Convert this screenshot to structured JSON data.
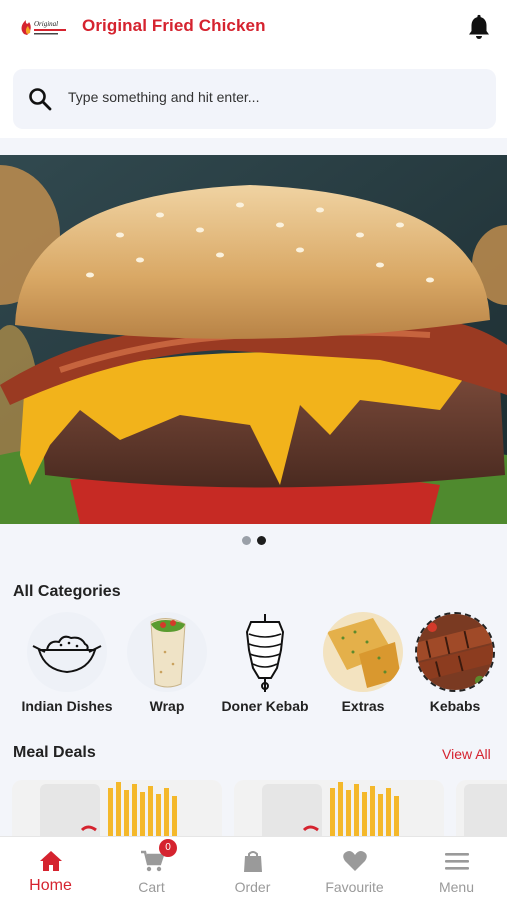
{
  "header": {
    "logo_text": "Original",
    "title": "Original Fried Chicken"
  },
  "search": {
    "placeholder": "Type something and hit enter..."
  },
  "carousel": {
    "slide_count": 2,
    "active_index": 1
  },
  "categories": {
    "title": "All Categories",
    "items": [
      {
        "label": "Indian Dishes",
        "icon": "rice-bowl-icon"
      },
      {
        "label": "Wrap",
        "icon": "wrap-icon"
      },
      {
        "label": "Doner Kebab",
        "icon": "doner-kebab-icon"
      },
      {
        "label": "Extras",
        "icon": "garlic-bread-image"
      },
      {
        "label": "Kebabs",
        "icon": "kebab-image"
      }
    ]
  },
  "meal_deals": {
    "title": "Meal Deals",
    "view_all_label": "View All"
  },
  "bottom_nav": {
    "items": [
      {
        "label": "Home",
        "icon": "home-icon",
        "active": true
      },
      {
        "label": "Cart",
        "icon": "cart-icon",
        "badge": "0"
      },
      {
        "label": "Order",
        "icon": "bag-icon"
      },
      {
        "label": "Favourite",
        "icon": "heart-icon"
      },
      {
        "label": "Menu",
        "icon": "menu-icon"
      }
    ]
  },
  "colors": {
    "brand": "#d5232f",
    "background": "#f3f5fa",
    "muted": "#9a9a9a"
  }
}
